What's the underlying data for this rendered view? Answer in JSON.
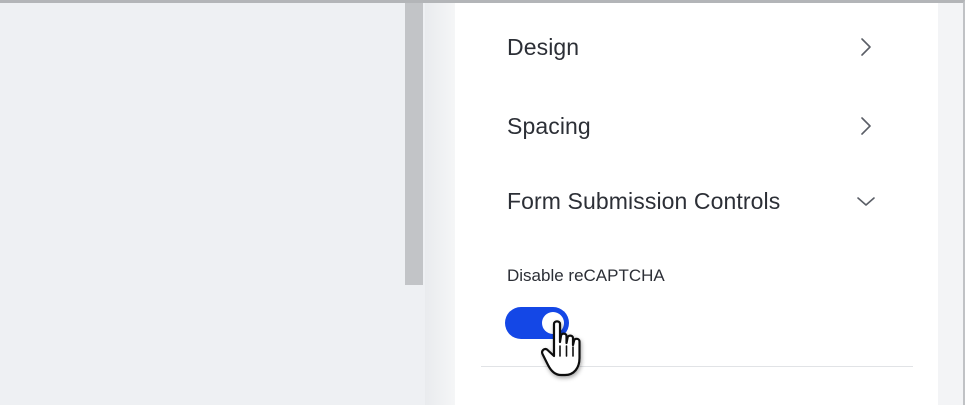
{
  "panel": {
    "sections": [
      {
        "label": "Design",
        "state": "collapsed",
        "icon": "chevron-right-icon"
      },
      {
        "label": "Spacing",
        "state": "collapsed",
        "icon": "chevron-right-icon"
      },
      {
        "label": "Form Submission Controls",
        "state": "expanded",
        "icon": "chevron-down-icon"
      }
    ],
    "form_submission_controls": {
      "disable_recaptcha_label": "Disable reCAPTCHA",
      "disable_recaptcha_enabled": true
    }
  },
  "colors": {
    "toggle_on": "#1447e6",
    "text": "#2c2f36",
    "canvas_bg": "#eef0f3",
    "scrollbar_thumb": "#c2c4c7"
  },
  "cursor": {
    "icon": "hand-pointer-icon"
  }
}
